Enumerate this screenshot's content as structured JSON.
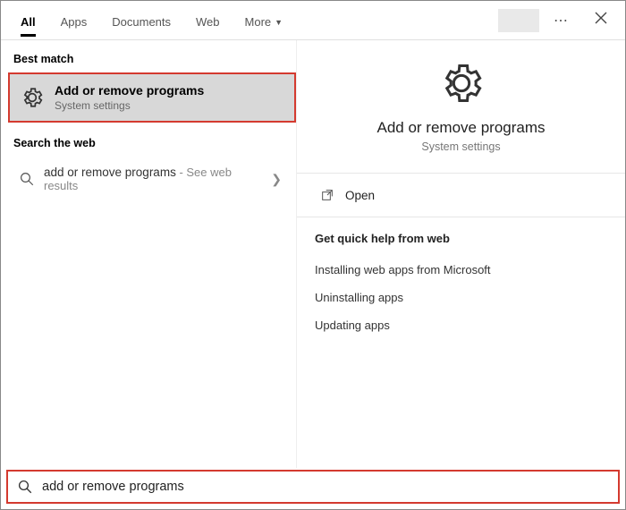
{
  "tabs": {
    "all": "All",
    "apps": "Apps",
    "documents": "Documents",
    "web": "Web",
    "more": "More"
  },
  "sections": {
    "best_match": "Best match",
    "search_web": "Search the web"
  },
  "best_match": {
    "title": "Add or remove programs",
    "subtitle": "System settings"
  },
  "web_result": {
    "text": "add or remove programs",
    "sub": " - See web results"
  },
  "detail": {
    "title": "Add or remove programs",
    "subtitle": "System settings",
    "open": "Open"
  },
  "quick_help": {
    "label": "Get quick help from web",
    "links": [
      "Installing web apps from Microsoft",
      "Uninstalling apps",
      "Updating apps"
    ]
  },
  "search": {
    "value": "add or remove programs"
  },
  "colors": {
    "highlight": "#d43a2f"
  }
}
